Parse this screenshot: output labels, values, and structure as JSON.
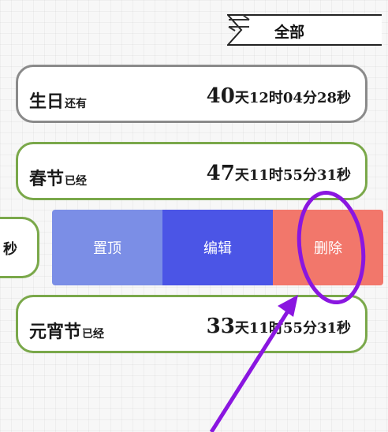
{
  "filter": {
    "label": "全部"
  },
  "cards": [
    {
      "name": "生日",
      "status": "还有",
      "d": "40",
      "h": "12",
      "m": "04",
      "s": "28"
    },
    {
      "name": "春节",
      "status": "已经",
      "d": "47",
      "h": "11",
      "m": "55",
      "s": "31"
    },
    {
      "name": "元宵节",
      "status": "已经",
      "d": "33",
      "h": "11",
      "m": "55",
      "s": "31"
    }
  ],
  "units": {
    "day": "天",
    "hour": "时",
    "minute": "分",
    "second": "秒"
  },
  "stub_text": "秒",
  "actions": {
    "pin": "置顶",
    "edit": "编辑",
    "delete": "删除"
  },
  "colors": {
    "pin": "#7b8ee6",
    "edit": "#4b55e6",
    "delete": "#f2776b",
    "annotation": "#8a16e0"
  }
}
